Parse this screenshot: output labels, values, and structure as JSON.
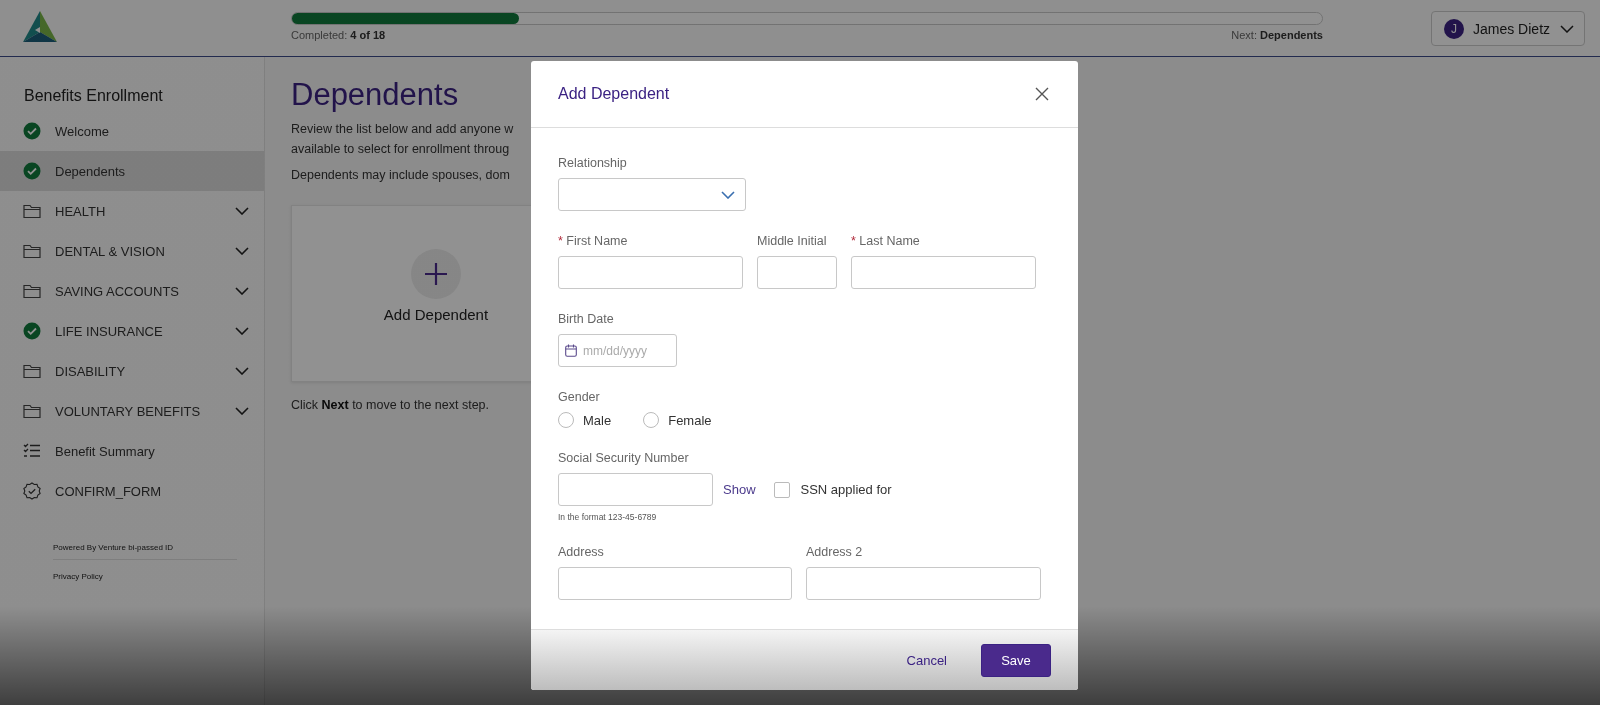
{
  "header": {
    "progress": {
      "label": "Completed:",
      "count": "4 of 18",
      "level": 0.22,
      "next_label": "Next:",
      "next": "Dependents"
    },
    "user": {
      "initial": "J",
      "name": "James Dietz"
    }
  },
  "sidebar": {
    "title": "Benefits Enrollment",
    "items": [
      {
        "label": "Welcome",
        "kind": "done",
        "selected": false
      },
      {
        "label": "Dependents",
        "kind": "done",
        "selected": true
      },
      {
        "label": "HEALTH",
        "kind": "folder",
        "selected": false,
        "expanded": false
      },
      {
        "label": "DENTAL & VISION",
        "kind": "folder",
        "selected": false,
        "expanded": false
      },
      {
        "label": "SAVING ACCOUNTS",
        "kind": "folder",
        "selected": false,
        "expanded": false
      },
      {
        "label": "LIFE INSURANCE",
        "kind": "done",
        "selected": false,
        "expanded": false
      },
      {
        "label": "DISABILITY",
        "kind": "folder",
        "selected": false,
        "expanded": false
      },
      {
        "label": "VOLUNTARY BENEFITS",
        "kind": "folder",
        "selected": false,
        "expanded": false
      },
      {
        "label": "Benefit Summary",
        "kind": "list",
        "selected": false
      },
      {
        "label": "CONFIRM_FORM",
        "kind": "badge",
        "selected": false
      }
    ],
    "footer": {
      "powered": "Powered By Venture  bi-passed ID",
      "privacy": "Privacy Policy"
    }
  },
  "main": {
    "title": "Dependents",
    "lines": [
      "Review the list below and add anyone w",
      "available to select for enrollment throug"
    ],
    "note": "Dependents may include spouses, dom",
    "add_card": "Add Dependent",
    "hint": "Click **Next** to move to the next step."
  },
  "dialog": {
    "title": "Add Dependent",
    "relationship": {
      "label": "Relationship"
    },
    "first_name": {
      "label": "First Name",
      "required_mark": "*"
    },
    "middle_initial": {
      "label": "Middle Initial"
    },
    "last_name": {
      "label": "Last Name",
      "required_mark": "*"
    },
    "birth_date": {
      "label": "Birth Date",
      "placeholder": "mm/dd/yyyy"
    },
    "gender": {
      "label": "Gender",
      "options": [
        {
          "label": "Male",
          "selected": false
        },
        {
          "label": "Female",
          "selected": false
        }
      ]
    },
    "ssn": {
      "label": "Social Security Number",
      "show": "Show",
      "applied": {
        "label": "SSN applied for",
        "checked": false
      },
      "help": "In the format 123-45-6789"
    },
    "address": {
      "label": "Address"
    },
    "address2": {
      "label": "Address 2"
    },
    "buttons": {
      "cancel": "Cancel",
      "save": "Save"
    }
  }
}
